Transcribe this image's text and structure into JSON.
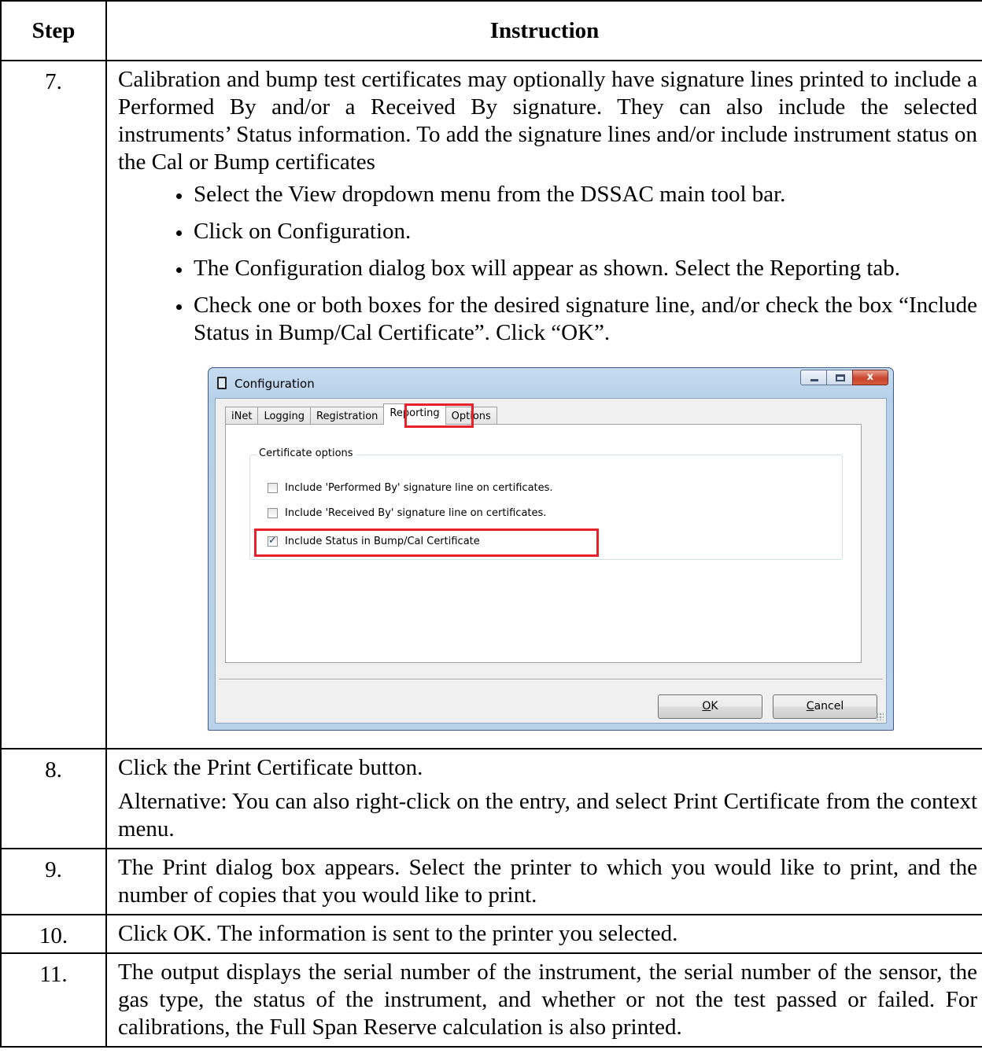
{
  "table": {
    "header_step": "Step",
    "header_instruction": "Instruction",
    "rows": [
      {
        "step": "7.",
        "text": "Calibration and bump test certificates may optionally have signature lines printed to include a Performed By and/or a Received By signature. They can also include the selected instruments’ Status information.  To add the signature lines and/or include instrument status on the Cal or Bump certificates",
        "bullets": [
          "Select the View dropdown menu from the DSSAC main tool bar.",
          "Click on Configuration.",
          "The Configuration dialog box will appear as shown.  Select the Reporting tab.",
          "Check one or both boxes for the desired signature line, and/or check the box “Include Status in Bump/Cal Certificate”. Click “OK”."
        ]
      },
      {
        "step": "8.",
        "text": "Click the Print Certificate button.",
        "alt": "Alternative:  You can also right-click on the entry, and select Print Certificate from the context menu."
      },
      {
        "step": "9.",
        "text": "The Print dialog box appears.  Select the printer to which you would like to print, and the number of copies that you would like to print."
      },
      {
        "step": "10.",
        "text": "Click OK.  The information is sent to the printer you selected."
      },
      {
        "step": "11.",
        "text": "The output displays the serial number of the instrument, the serial number of the sensor, the gas type, the status of the instrument, and whether or not the test passed or failed.  For calibrations, the Full Span Reserve calculation is also printed."
      }
    ]
  },
  "dialog": {
    "title": "Configuration",
    "close_glyph": "x",
    "tabs": [
      "iNet",
      "Logging",
      "Registration",
      "Reporting",
      "Options"
    ],
    "active_tab": "Reporting",
    "group_label": "Certificate options",
    "options": [
      {
        "label": "Include 'Performed By' signature line on certificates.",
        "checked": false
      },
      {
        "label": "Include 'Received By' signature line on certificates.",
        "checked": false
      },
      {
        "label": "Include Status in Bump/Cal Certificate",
        "checked": true
      }
    ],
    "ok_accel": "O",
    "ok_rest": "K",
    "cancel_accel": "C",
    "cancel_rest": "ancel",
    "highlight_color": "#e8202a"
  }
}
